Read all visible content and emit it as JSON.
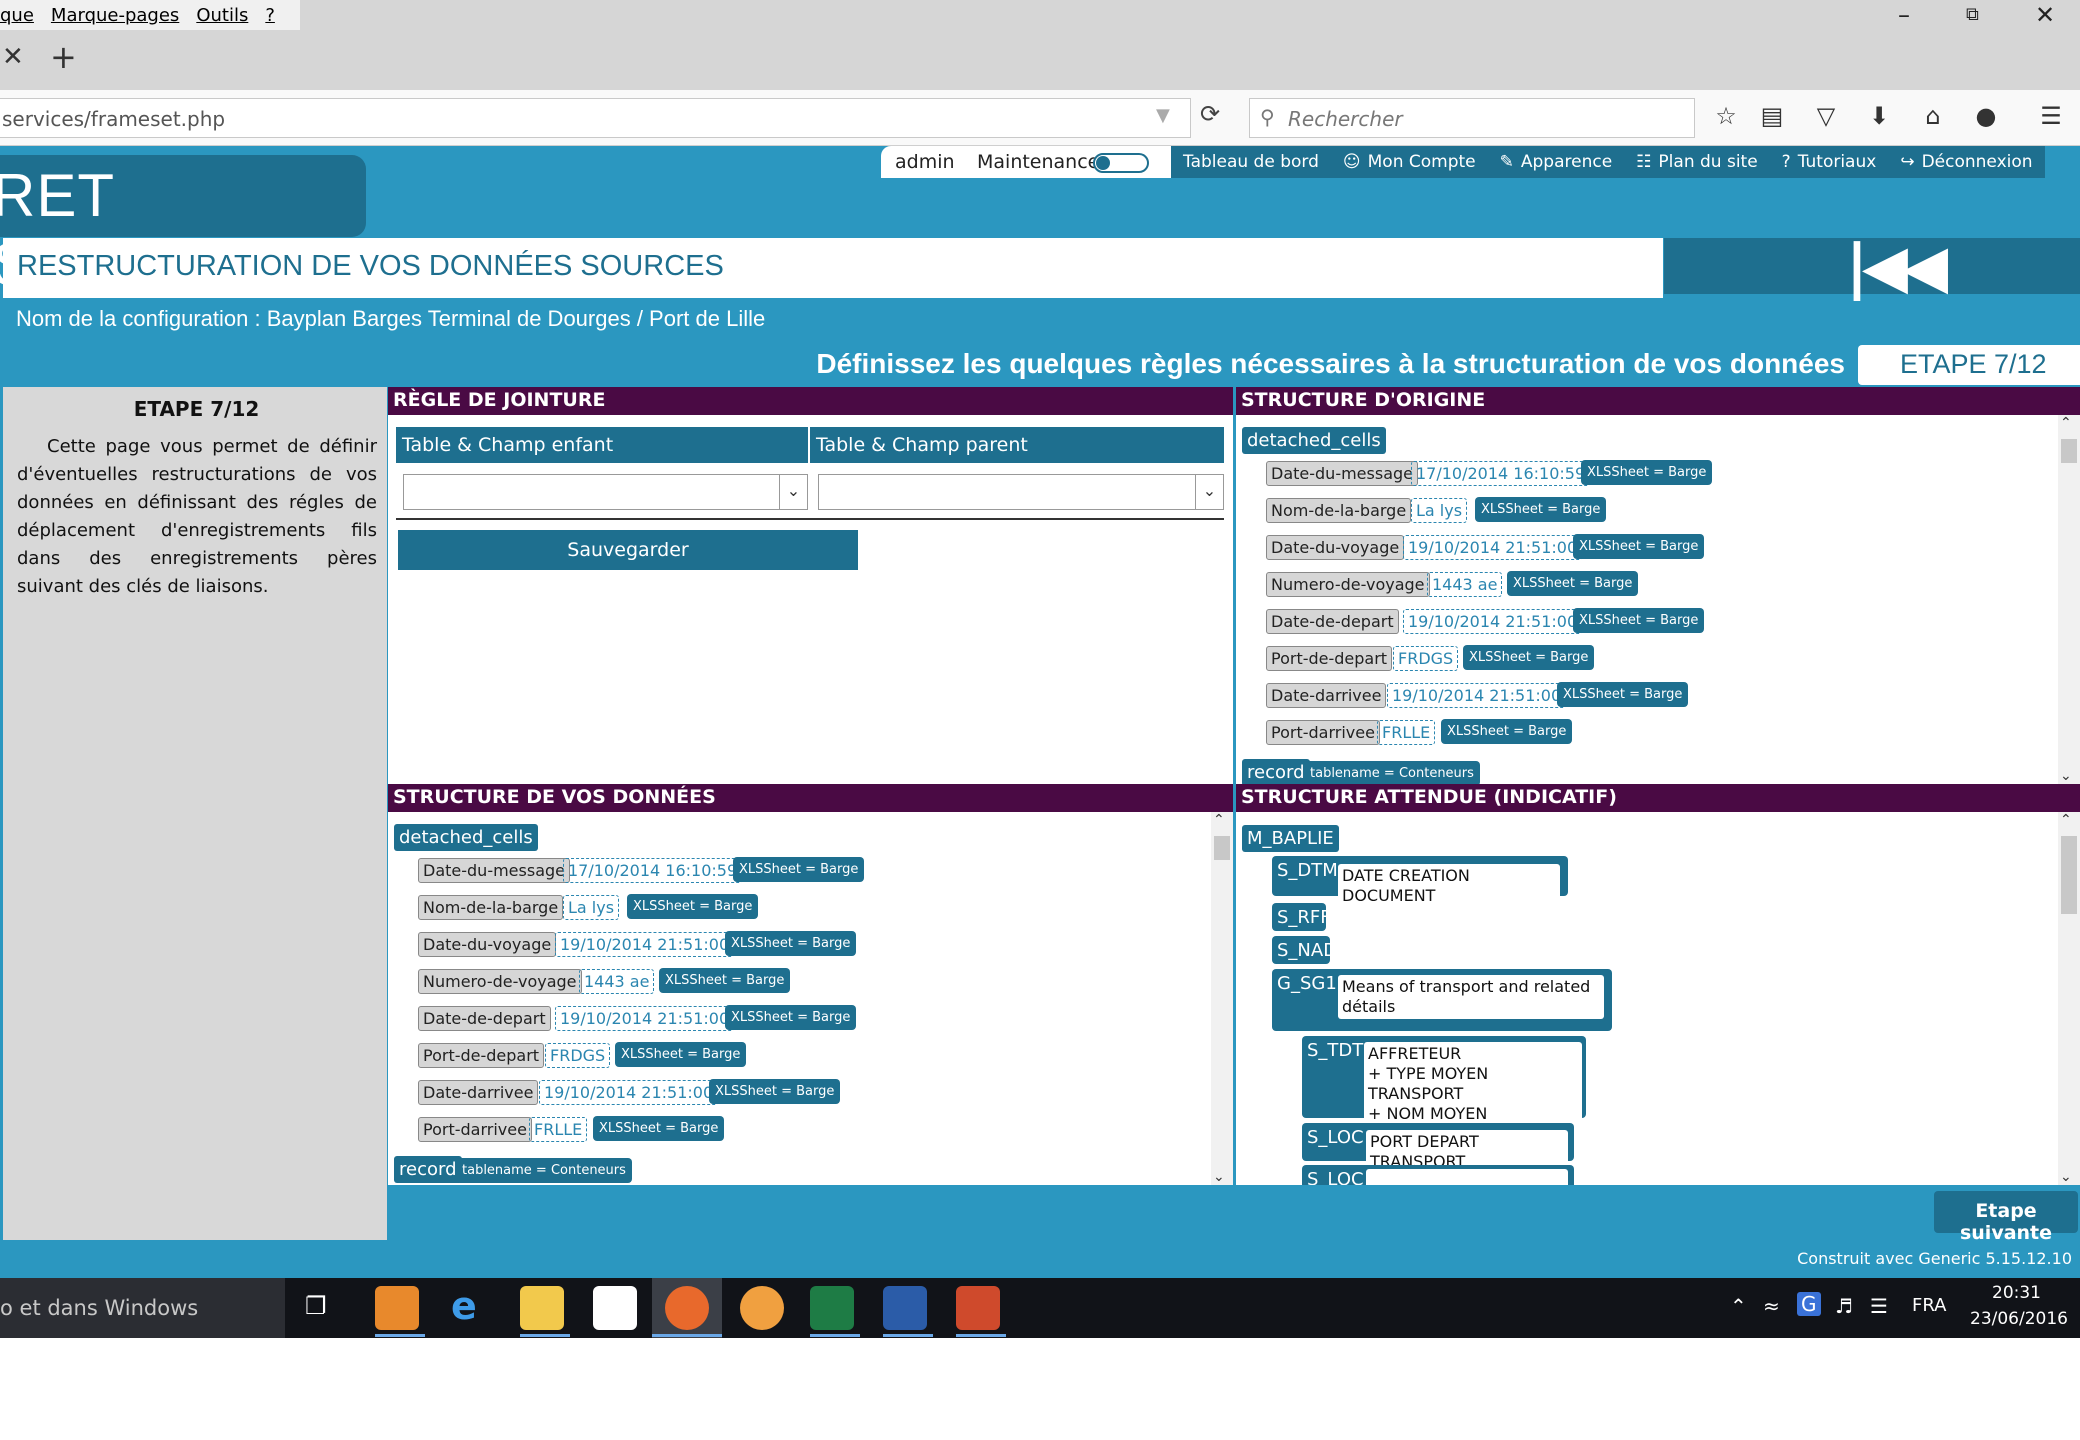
{
  "browser": {
    "menus": [
      "que",
      "Marque-pages",
      "Outils",
      "?"
    ],
    "url": "services/frameset.php",
    "search_placeholder": "Rechercher"
  },
  "site": {
    "logo": "RET SERVICES",
    "user": "admin",
    "maintenance_label": "Maintenance",
    "nav": [
      {
        "label": "Tableau de bord",
        "icon": "dashboard-icon"
      },
      {
        "label": "Mon Compte",
        "icon": "user-icon"
      },
      {
        "label": "Apparence",
        "icon": "brush-icon"
      },
      {
        "label": "Plan du site",
        "icon": "sitemap-icon"
      },
      {
        "label": "Tutoriaux",
        "icon": "help-icon"
      },
      {
        "label": "Déconnexion",
        "icon": "logout-icon"
      }
    ],
    "page_title": "RESTRUCTURATION DE VOS DONNÉES SOURCES",
    "config_line": "Nom de la configuration : Bayplan Barges Terminal de Dourges / Port de Lille",
    "step_instruction": "Définissez les quelques règles nécessaires à la structuration de vos données",
    "step_label": "ETAPE 7/12",
    "left_title": "ETAPE 7/12",
    "left_text": "Cette page vous permet de définir d'éventuelles restructurations de vos données en définissant des régles de déplacement d'enregistrements fils dans des enregistrements pères suivant des clés de liaisons.",
    "next_button": "Etape suivante",
    "footer": "Construit avec Generic 5.15.12.10"
  },
  "jointure": {
    "title": "RÈGLE DE JOINTURE",
    "col_child": "Table & Champ enfant",
    "col_parent": "Table & Champ parent",
    "save_button": "Sauvegarder"
  },
  "origine": {
    "title": "STRUCTURE D'ORIGINE",
    "root": "detached_cells",
    "fields": [
      {
        "name": "Date-du-message",
        "value": "17/10/2014 16:10:59",
        "badge": "XLSSheet = Barge"
      },
      {
        "name": "Nom-de-la-barge",
        "value": "La lys",
        "badge": "XLSSheet = Barge"
      },
      {
        "name": "Date-du-voyage",
        "value": "19/10/2014 21:51:00",
        "badge": "XLSSheet = Barge"
      },
      {
        "name": "Numero-de-voyage",
        "value": "1443 ae",
        "badge": "XLSSheet = Barge"
      },
      {
        "name": "Date-de-depart",
        "value": "19/10/2014 21:51:00",
        "badge": "XLSSheet = Barge"
      },
      {
        "name": "Port-de-depart",
        "value": "FRDGS",
        "badge": "XLSSheet = Barge"
      },
      {
        "name": "Date-darrivee",
        "value": "19/10/2014 21:51:00",
        "badge": "XLSSheet = Barge"
      },
      {
        "name": "Port-darrivee",
        "value": "FRLLE",
        "badge": "XLSSheet = Barge"
      }
    ],
    "record": "record",
    "record_badge": "tablename = Conteneurs"
  },
  "donnees": {
    "title": "STRUCTURE DE VOS DONNÉES",
    "root": "detached_cells",
    "record": "record",
    "record_badge": "tablename = Conteneurs"
  },
  "attendue": {
    "title": "STRUCTURE ATTENDUE (INDICATIF)",
    "root": "M_BAPLIE",
    "segments": [
      {
        "code": "S_DTM",
        "desc": "DATE CREATION DOCUMENT"
      },
      {
        "code": "S_RFF"
      },
      {
        "code": "S_NAD"
      },
      {
        "code": "G_SG1",
        "desc": "Means of transport and related détails"
      },
      {
        "code": "S_TDT",
        "desc": "AFFRETEUR\n+ TYPE MOYEN TRANSPORT\n+ NOM MOYEN TRANSPORT"
      },
      {
        "code": "S_LOC",
        "desc": "PORT DEPART TRANSPORT"
      },
      {
        "code": "S_LOC"
      }
    ]
  },
  "taskbar": {
    "search_text": "o et dans Windows",
    "language": "FRA",
    "time": "20:31",
    "date": "23/06/2016"
  }
}
